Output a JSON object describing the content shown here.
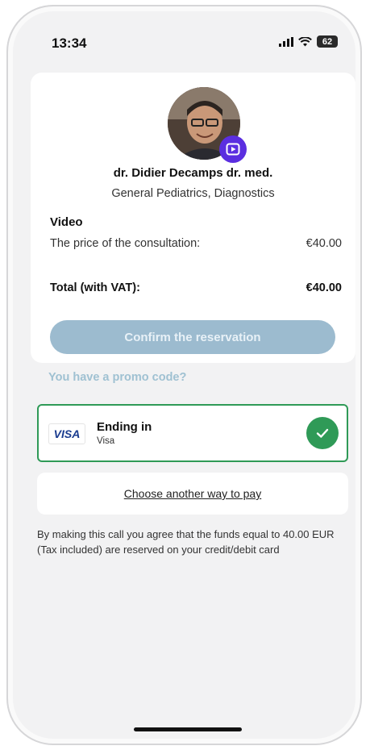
{
  "status_bar": {
    "time": "13:34",
    "battery": "62"
  },
  "doctor": {
    "name": "dr.  Didier Decamps dr. med.",
    "specialty": "General Pediatrics, Diagnostics",
    "avatar_icon": "doctor-photo",
    "badge_icon": "video-play-icon"
  },
  "consultation": {
    "type_label": "Video",
    "price_label": "The price of the consultation:",
    "price_value": "€40.00",
    "total_label": "Total (with VAT):",
    "total_value": "€40.00"
  },
  "actions": {
    "confirm_label": "Confirm the reservation",
    "promo_label": "You have a promo code?"
  },
  "payment": {
    "card_brand": "VISA",
    "title": "Ending in",
    "subtitle": "Visa",
    "other_label": "Choose another way to pay",
    "selected_color": "#2f9a57"
  },
  "disclaimer": "By making this call you agree that the funds equal to 40.00 EUR (Tax included) are reserved on your credit/debit card",
  "colors": {
    "accent_badge": "#5b2ee0",
    "confirm_button": "#9cbbcf",
    "promo_text": "#9fc1d2"
  }
}
